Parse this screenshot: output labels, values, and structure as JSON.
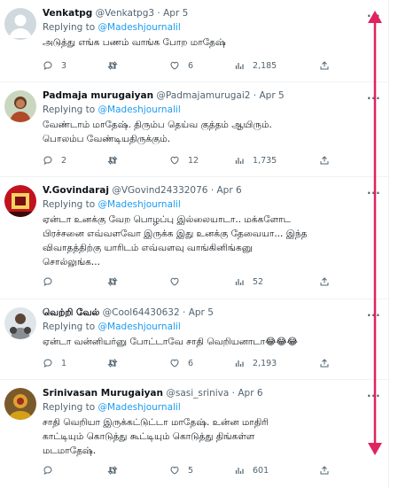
{
  "tweets": [
    {
      "name": "Venkatpg",
      "handle": "@Venkatpg3",
      "date": "Apr 5",
      "replying_prefix": "Replying to ",
      "replying_to": "@Madeshjournalil",
      "text": "அடுத்து எங்க பணம் வாங்க போற மாதேஷ்",
      "replies": "3",
      "retweets": "",
      "likes": "6",
      "views": "2,185",
      "avatar": "default-avatar"
    },
    {
      "name": "Padmaja murugaiyan",
      "handle": "@Padmajamurugai2",
      "date": "Apr 5",
      "replying_prefix": "Replying to ",
      "replying_to": "@Madeshjournalil",
      "text": "வேண்டாம் மாதேஷ். திரும்ப தெய்வ குத்தம் ஆயிரும்.\nபொலம்ப வேண்டியதிருக்கும்.",
      "replies": "2",
      "retweets": "",
      "likes": "12",
      "views": "1,735",
      "avatar": "photo-avatar"
    },
    {
      "name": "V.Govindaraj",
      "handle": "@VGovind24332076",
      "date": "Apr 6",
      "replying_prefix": "Replying to ",
      "replying_to": "@Madeshjournalil",
      "text": "ஏன்டா உனக்கு வேற பொழப்பு இல்லையாடா.. மக்களோட\nபிரச்சனை எவ்வளவோ இருக்க இது உனக்கு தேவையா... இந்த\nவிவாதத்திற்கு யாரிடம் எவ்வளவு வாங்கினிங்கனு\nசொல்லுங்க...",
      "replies": "",
      "retweets": "",
      "likes": "",
      "views": "52",
      "avatar": "red-logo-avatar"
    },
    {
      "name": "வெற்றி வேல்",
      "handle": "@Cool64430632",
      "date": "Apr 5",
      "replying_prefix": "Replying to ",
      "replying_to": "@Madeshjournalil",
      "text": "ஏன்டா வன்னியர்னு போட்டாவே சாதி வெறியனாடா😂😂😂",
      "replies": "1",
      "retweets": "",
      "likes": "6",
      "views": "2,193",
      "avatar": "photo-avatar"
    },
    {
      "name": "Srinivasan Murugaiyan",
      "handle": "@sasi_sriniva",
      "date": "Apr 6",
      "replying_prefix": "Replying to ",
      "replying_to": "@Madeshjournalil",
      "text": "சாதி வெறியா இருக்கட்டுட்டா மாதேஷ். உன்ன மாதிரி\nகாட்டியும் கொடுத்து கூட்டியும் கொடுத்து திங்கள்ள\nமடமாதேஷ்.",
      "replies": "",
      "retweets": "",
      "likes": "5",
      "views": "601",
      "avatar": "photo-avatar"
    }
  ],
  "more_label": "···",
  "colors": {
    "link": "#1d9bf0",
    "muted": "#536471",
    "text": "#0f1419",
    "annotation": "#e0245e"
  },
  "annotation": "double-arrow"
}
